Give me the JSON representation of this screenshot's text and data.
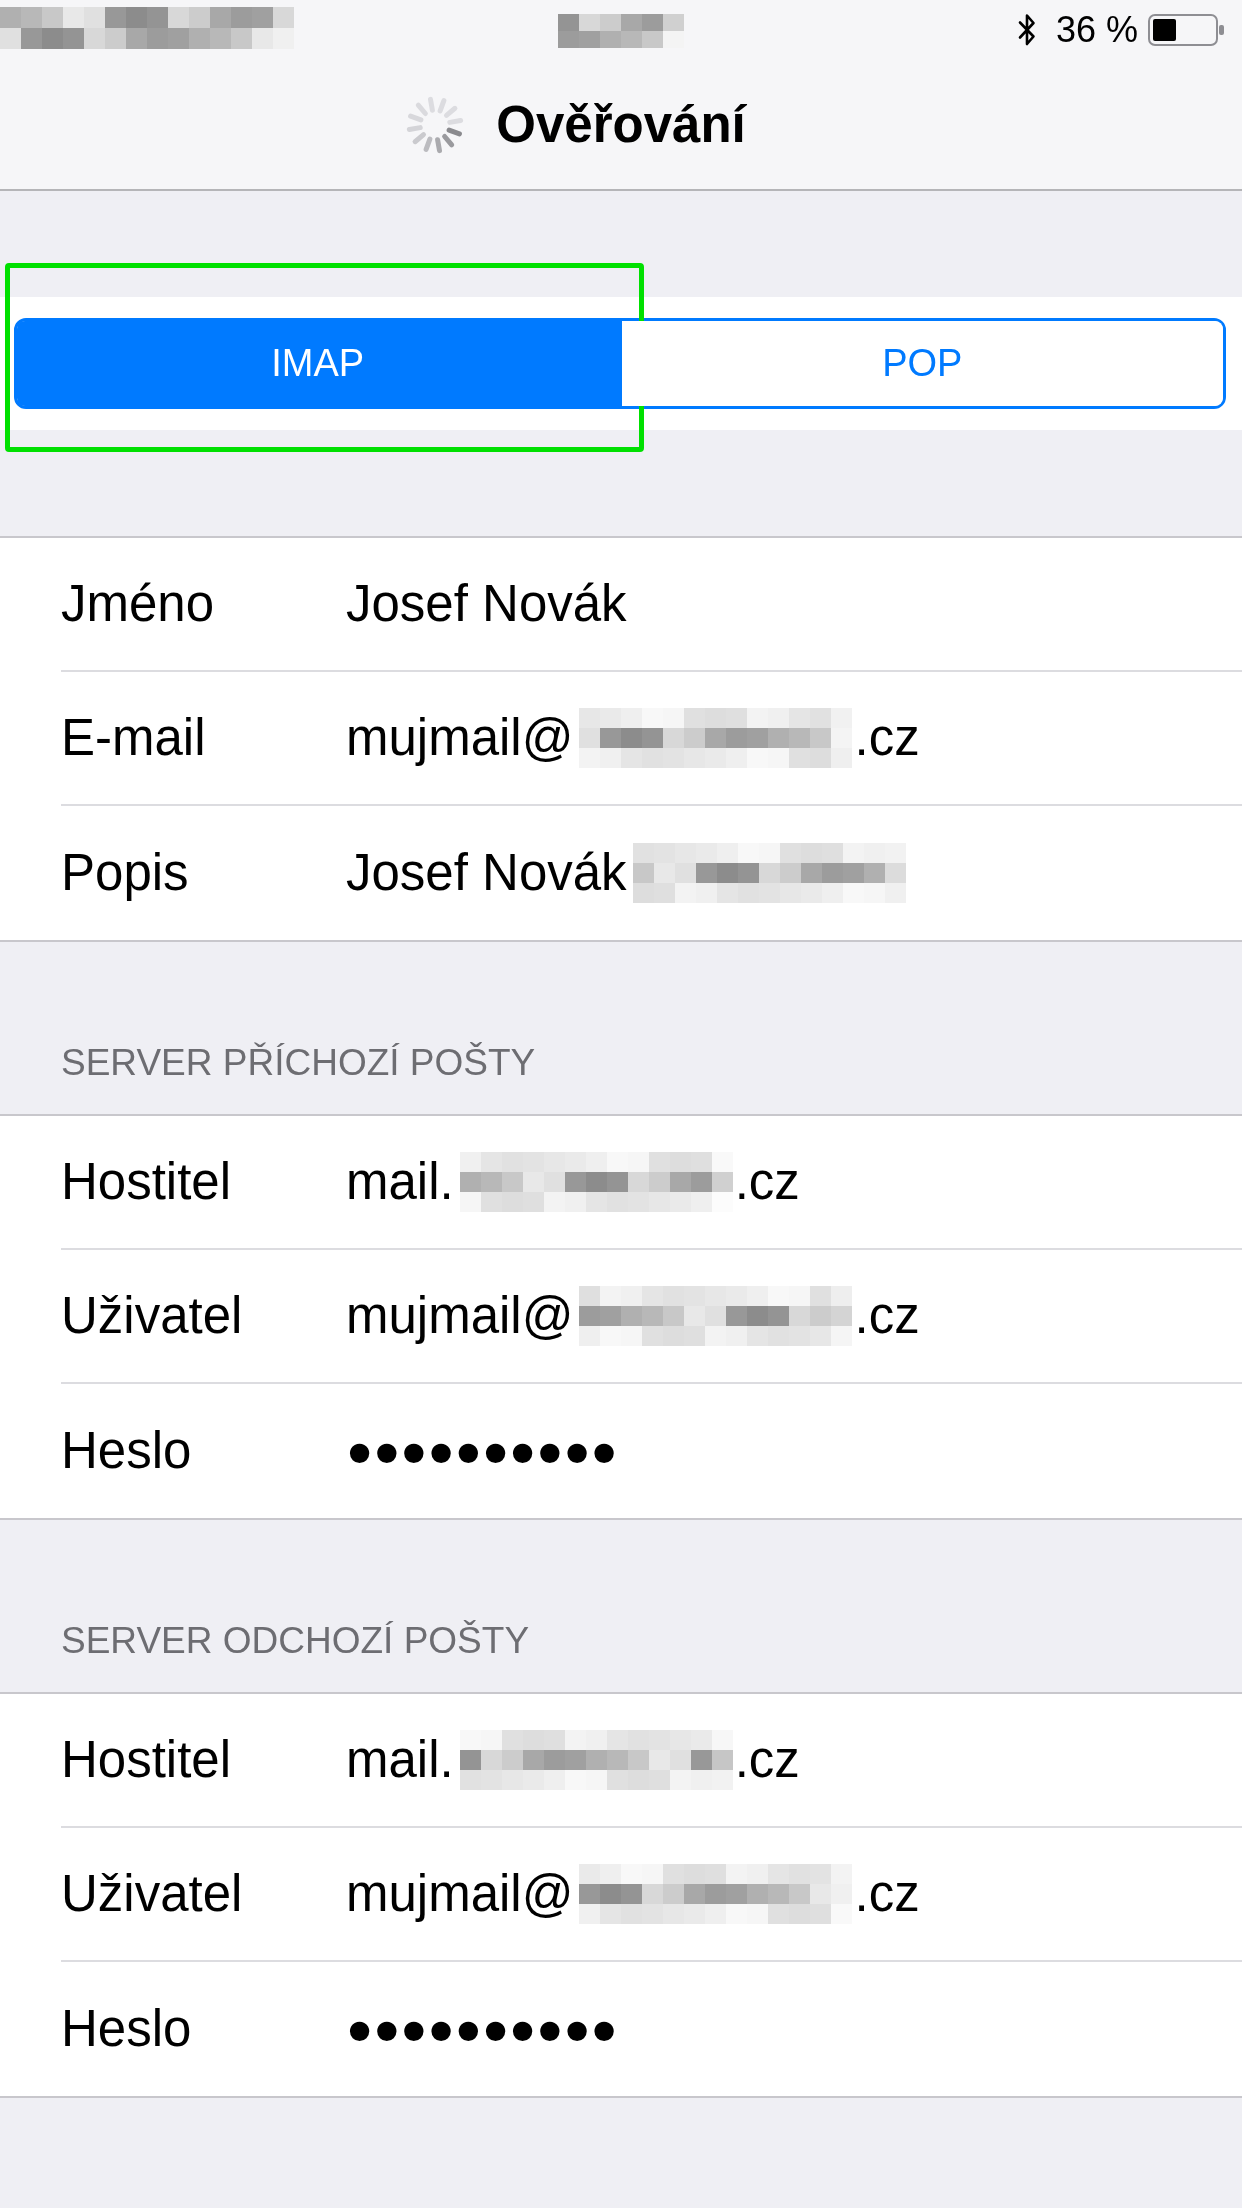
{
  "status_bar": {
    "left_redacted": true,
    "center_redacted": true,
    "battery": "36 %"
  },
  "nav_bar": {
    "title": "Ověřování",
    "loading": true
  },
  "account_type": {
    "segments": [
      {
        "label": "IMAP",
        "selected": true,
        "highlighted": true
      },
      {
        "label": "POP",
        "selected": false,
        "highlighted": false
      }
    ]
  },
  "sections": [
    {
      "rows": [
        {
          "label": "Jméno",
          "kind": "text",
          "value": "Josef Novák",
          "redacted": false
        },
        {
          "label": "E-mail",
          "kind": "text",
          "value": "mujmail@",
          "redacted": true,
          "value_suffix": ".cz"
        },
        {
          "label": "Popis",
          "kind": "text",
          "value": "Josef Novák",
          "redacted": true
        }
      ]
    },
    {
      "header": "SERVER PŘÍCHOZÍ POŠTY",
      "rows": [
        {
          "label": "Hostitel",
          "kind": "text",
          "value": "mail.",
          "redacted": true,
          "value_suffix": ".cz"
        },
        {
          "label": "Uživatel",
          "kind": "text",
          "value": "mujmail@",
          "redacted": true,
          "value_suffix": ".cz"
        },
        {
          "label": "Heslo",
          "kind": "password",
          "value": "●●●●●●●●●●",
          "redacted": false
        }
      ]
    },
    {
      "header": "SERVER ODCHOZÍ POŠTY",
      "rows": [
        {
          "label": "Hostitel",
          "kind": "text",
          "value": "mail.",
          "redacted": true,
          "value_suffix": ".cz"
        },
        {
          "label": "Uživatel",
          "kind": "text",
          "value": "mujmail@",
          "redacted": true,
          "value_suffix": ".cz"
        },
        {
          "label": "Heslo",
          "kind": "password",
          "value": "●●●●●●●●●●",
          "redacted": false
        }
      ]
    }
  ]
}
